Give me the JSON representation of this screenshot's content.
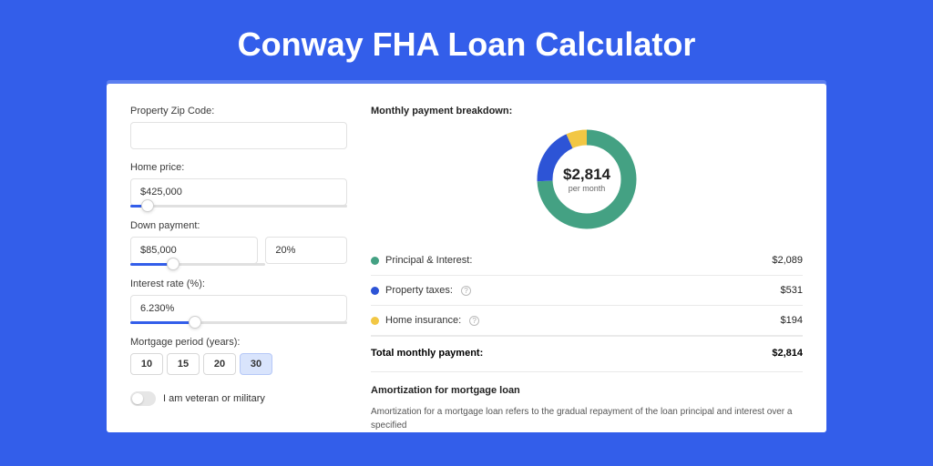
{
  "title": "Conway FHA Loan Calculator",
  "form": {
    "zip": {
      "label": "Property Zip Code:",
      "value": ""
    },
    "home_price": {
      "label": "Home price:",
      "value": "$425,000",
      "slider_pct": 8
    },
    "down_payment": {
      "label": "Down payment:",
      "value": "$85,000",
      "pct_value": "20%",
      "slider_pct": 20
    },
    "interest": {
      "label": "Interest rate (%):",
      "value": "6.230%",
      "slider_pct": 30
    },
    "period": {
      "label": "Mortgage period (years):",
      "options": [
        "10",
        "15",
        "20",
        "30"
      ],
      "selected": "30"
    },
    "veteran": {
      "label": "I am veteran or military",
      "checked": false
    }
  },
  "breakdown": {
    "title": "Monthly payment breakdown:",
    "center_amount": "$2,814",
    "center_sub": "per month",
    "rows": [
      {
        "label": "Principal & Interest:",
        "value": "$2,089",
        "color": "#44a183",
        "info": false
      },
      {
        "label": "Property taxes:",
        "value": "$531",
        "color": "#2d54d6",
        "info": true
      },
      {
        "label": "Home insurance:",
        "value": "$194",
        "color": "#f2c744",
        "info": true
      }
    ],
    "total_label": "Total monthly payment:",
    "total_value": "$2,814"
  },
  "amort": {
    "title": "Amortization for mortgage loan",
    "text": "Amortization for a mortgage loan refers to the gradual repayment of the loan principal and interest over a specified"
  },
  "chart_data": {
    "type": "pie",
    "title": "Monthly payment breakdown",
    "series": [
      {
        "name": "Principal & Interest",
        "value": 2089,
        "color": "#44a183"
      },
      {
        "name": "Property taxes",
        "value": 531,
        "color": "#2d54d6"
      },
      {
        "name": "Home insurance",
        "value": 194,
        "color": "#f2c744"
      }
    ],
    "total": 2814,
    "unit": "USD per month"
  }
}
